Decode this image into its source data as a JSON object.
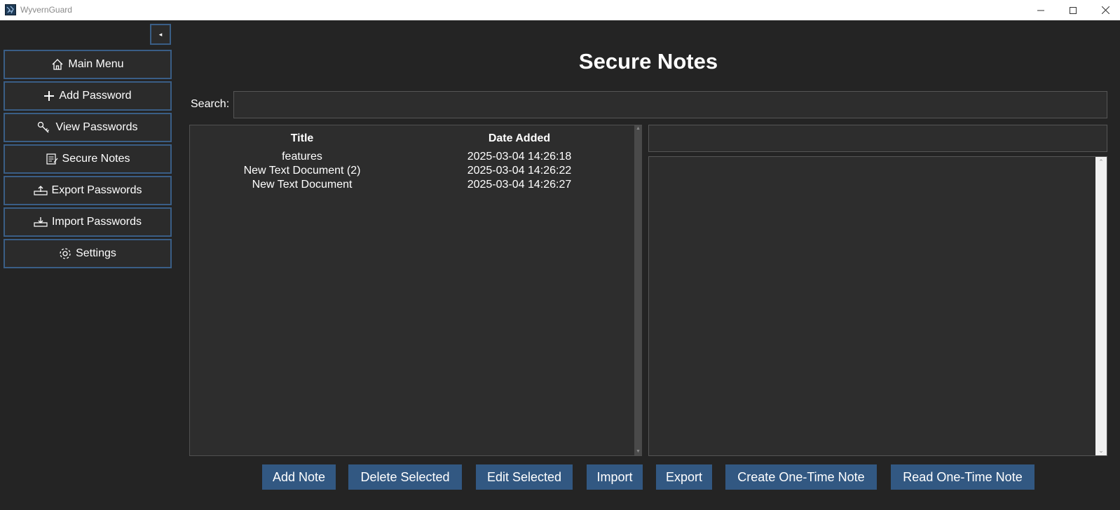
{
  "window": {
    "title": "WyvernGuard",
    "minimize_symbol": "—",
    "maximize_symbol": "☐",
    "close_symbol": "✕"
  },
  "sidebar": {
    "collapse_symbol": "◂",
    "items": [
      {
        "label": "Main Menu",
        "icon": "home-icon"
      },
      {
        "label": "Add Password",
        "icon": "plus-icon"
      },
      {
        "label": "View Passwords",
        "icon": "key-icon"
      },
      {
        "label": "Secure Notes",
        "icon": "note-icon"
      },
      {
        "label": "Export Passwords",
        "icon": "export-icon"
      },
      {
        "label": "Import Passwords",
        "icon": "import-icon"
      },
      {
        "label": "Settings",
        "icon": "gear-icon"
      }
    ]
  },
  "main": {
    "title": "Secure Notes",
    "search": {
      "label": "Search:",
      "value": "",
      "placeholder": ""
    },
    "table": {
      "headers": [
        "Title",
        "Date Added"
      ],
      "rows": [
        {
          "title": "features",
          "date": "2025-03-04 14:26:18"
        },
        {
          "title": "New Text Document (2)",
          "date": "2025-03-04 14:26:22"
        },
        {
          "title": "New Text Document",
          "date": "2025-03-04 14:26:27"
        }
      ]
    },
    "note_title": {
      "value": "",
      "placeholder": ""
    },
    "note_body": {
      "value": ""
    },
    "actions": [
      "Add Note",
      "Delete Selected",
      "Edit Selected",
      "Import",
      "Export",
      "Create One-Time Note",
      "Read One-Time Note"
    ]
  },
  "colors": {
    "background": "#242424",
    "panel": "#2d2d2d",
    "accent": "#325882",
    "nav_border": "#3a5e86"
  }
}
